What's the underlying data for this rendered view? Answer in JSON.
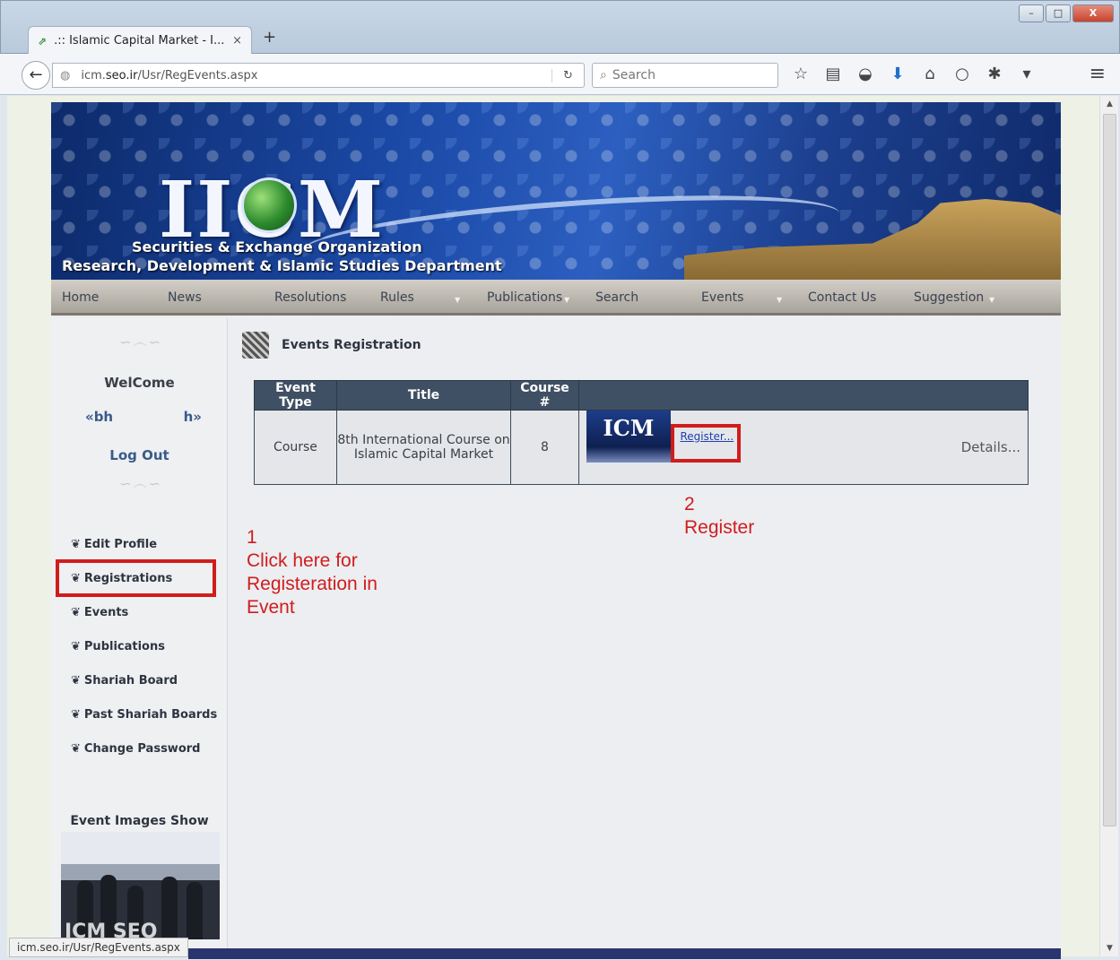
{
  "browser": {
    "tab_title": ".:: Islamic Capital Market - I...",
    "tab_close": "×",
    "new_tab": "+",
    "url_prefix": "icm.",
    "url_domain": "seo.ir",
    "url_path": "/Usr/RegEvents.aspx",
    "search_placeholder": "Search",
    "status_url": "icm.seo.ir/Usr/RegEvents.aspx"
  },
  "banner": {
    "logo": "IICM",
    "org": "Securities & Exchange Organization",
    "dept": "Research, Development & Islamic Studies Department"
  },
  "menu": [
    "Home",
    "News",
    "Resolutions",
    "Rules",
    "Publications",
    "Search",
    "Events",
    "Contact Us",
    "Suggestion"
  ],
  "sidebar": {
    "welcome": "WelCome",
    "user_left": "«bh",
    "user_right": "h»",
    "logout": "Log Out",
    "links": [
      "Edit Profile",
      "Registrations",
      "Events",
      "Publications",
      "Shariah Board",
      "Past Shariah Boards",
      "Change Password"
    ],
    "event_images_title": "Event Images Show",
    "event_image_caption": "ICM SEO"
  },
  "main": {
    "heading": "Events Registration",
    "table": {
      "headers": [
        "Event Type",
        "Title",
        "Course #",
        ""
      ],
      "rows": [
        {
          "event_type": "Course",
          "title_line1": "8th International Course on",
          "title_line2": "Islamic Capital Market",
          "course_no": "8",
          "image_text": "ICM",
          "register": "Register...",
          "details": "Details..."
        }
      ]
    }
  },
  "annotations": {
    "step1": "1\nClick here for\nRegisteration in\nEvent",
    "step2": "2\nRegister"
  },
  "colors": {
    "annotation_red": "#d11c1c",
    "table_header": "#3f5064",
    "link_blue": "#1f3fb0"
  }
}
